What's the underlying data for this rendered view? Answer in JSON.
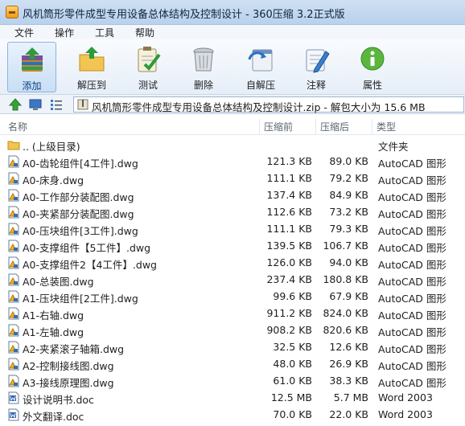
{
  "window": {
    "title": "风机筒形零件成型专用设备总体结构及控制设计 - 360压缩 3.2正式版"
  },
  "menu": [
    "文件",
    "操作",
    "工具",
    "帮助"
  ],
  "toolbar": [
    {
      "label": "添加",
      "icon": "add-archive-icon",
      "active": true
    },
    {
      "label": "解压到",
      "icon": "extract-folder-icon",
      "active": false
    },
    {
      "label": "测试",
      "icon": "test-clipboard-icon",
      "active": false
    },
    {
      "label": "删除",
      "icon": "trash-icon",
      "active": false
    },
    {
      "label": "自解压",
      "icon": "self-extract-icon",
      "active": false
    },
    {
      "label": "注释",
      "icon": "comment-icon",
      "active": false
    },
    {
      "label": "属性",
      "icon": "info-icon",
      "active": false
    }
  ],
  "address": {
    "path": "风机筒形零件成型专用设备总体结构及控制设计.zip - 解包大小为 15.6 MB"
  },
  "columns": [
    "名称",
    "压缩前",
    "压缩后",
    "类型"
  ],
  "files": [
    {
      "name": ".. (上级目录)",
      "size": "",
      "packed": "",
      "type": "文件夹",
      "icon": "folder-icon"
    },
    {
      "name": "A0-齿轮组件[4工件].dwg",
      "size": "121.3 KB",
      "packed": "89.0 KB",
      "type": "AutoCAD 图形",
      "icon": "dwg-file-icon"
    },
    {
      "name": "A0-床身.dwg",
      "size": "111.1 KB",
      "packed": "79.2 KB",
      "type": "AutoCAD 图形",
      "icon": "dwg-file-icon"
    },
    {
      "name": "A0-工作部分装配图.dwg",
      "size": "137.4 KB",
      "packed": "84.9 KB",
      "type": "AutoCAD 图形",
      "icon": "dwg-file-icon"
    },
    {
      "name": "A0-夹紧部分装配图.dwg",
      "size": "112.6 KB",
      "packed": "73.2 KB",
      "type": "AutoCAD 图形",
      "icon": "dwg-file-icon"
    },
    {
      "name": "A0-压块组件[3工件].dwg",
      "size": "111.1 KB",
      "packed": "79.3 KB",
      "type": "AutoCAD 图形",
      "icon": "dwg-file-icon"
    },
    {
      "name": "A0-支撑组件【5工件】.dwg",
      "size": "139.5 KB",
      "packed": "106.7 KB",
      "type": "AutoCAD 图形",
      "icon": "dwg-file-icon"
    },
    {
      "name": "A0-支撑组件2【4工件】.dwg",
      "size": "126.0 KB",
      "packed": "94.0 KB",
      "type": "AutoCAD 图形",
      "icon": "dwg-file-icon"
    },
    {
      "name": "A0-总装图.dwg",
      "size": "237.4 KB",
      "packed": "180.8 KB",
      "type": "AutoCAD 图形",
      "icon": "dwg-file-icon"
    },
    {
      "name": "A1-压块组件[2工件].dwg",
      "size": "99.6 KB",
      "packed": "67.9 KB",
      "type": "AutoCAD 图形",
      "icon": "dwg-file-icon"
    },
    {
      "name": "A1-右轴.dwg",
      "size": "911.2 KB",
      "packed": "824.0 KB",
      "type": "AutoCAD 图形",
      "icon": "dwg-file-icon"
    },
    {
      "name": "A1-左轴.dwg",
      "size": "908.2 KB",
      "packed": "820.6 KB",
      "type": "AutoCAD 图形",
      "icon": "dwg-file-icon"
    },
    {
      "name": "A2-夹紧滚子轴箱.dwg",
      "size": "32.5 KB",
      "packed": "12.6 KB",
      "type": "AutoCAD 图形",
      "icon": "dwg-file-icon"
    },
    {
      "name": "A2-控制接线图.dwg",
      "size": "48.0 KB",
      "packed": "26.9 KB",
      "type": "AutoCAD 图形",
      "icon": "dwg-file-icon"
    },
    {
      "name": "A3-接线原理图.dwg",
      "size": "61.0 KB",
      "packed": "38.3 KB",
      "type": "AutoCAD 图形",
      "icon": "dwg-file-icon"
    },
    {
      "name": "设计说明书.doc",
      "size": "12.5 MB",
      "packed": "5.7 MB",
      "type": "Word 2003",
      "icon": "word-file-icon"
    },
    {
      "name": "外文翻译.doc",
      "size": "70.0 KB",
      "packed": "22.0 KB",
      "type": "Word 2003",
      "icon": "word-file-icon"
    }
  ]
}
